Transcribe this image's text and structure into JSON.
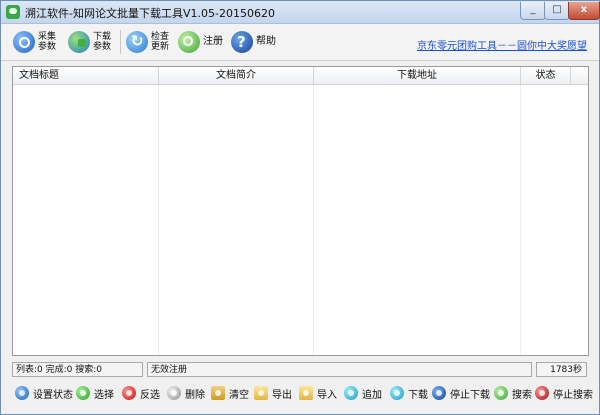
{
  "window": {
    "title": "溯江软件-知网论文批量下载工具V1.05-20150620"
  },
  "toolbar": {
    "collect_params": "采集参数",
    "download_params": "下载参数",
    "check_update": "检查更新",
    "register": "注册",
    "help": "帮助",
    "promo_link": "京东零元团购工具－－圆你中大奖愿望"
  },
  "table": {
    "columns": [
      "文档标题",
      "文档简介",
      "下载地址",
      "状态"
    ]
  },
  "status": {
    "counts": "列表:0 完成:0 搜索:0",
    "registration": "无效注册",
    "timer": "1783秒"
  },
  "bottom_toolbar": {
    "set_status": "设置状态",
    "select": "选择",
    "invert": "反选",
    "delete": "删除",
    "clear": "清空",
    "export": "导出",
    "import": "导入",
    "append": "追加",
    "download": "下载",
    "stop_download": "停止下载",
    "search": "搜索",
    "stop_search": "停止搜索"
  }
}
